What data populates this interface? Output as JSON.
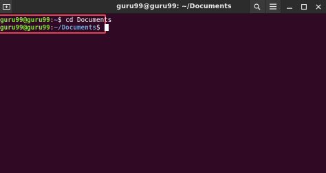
{
  "window": {
    "title": "guru99@guru99: ~/Documents"
  },
  "titlebar_buttons": {
    "new_tab_icon": "new-tab-icon",
    "search_icon": "search-icon",
    "menu_icon": "hamburger-menu-icon",
    "minimize_icon": "minimize-icon",
    "maximize_icon": "maximize-icon",
    "close_icon": "close-icon"
  },
  "terminal": {
    "background": "#300a24",
    "lines": [
      {
        "user_host": "guru99@guru99",
        "sep": ":",
        "path": "~",
        "prompt_end": "$",
        "command": " cd Documents"
      },
      {
        "user_host": "guru99@guru99",
        "sep": ":",
        "path": "~/Documents",
        "prompt_end": "$",
        "command": ""
      }
    ],
    "highlight_color": "#e0454f"
  }
}
